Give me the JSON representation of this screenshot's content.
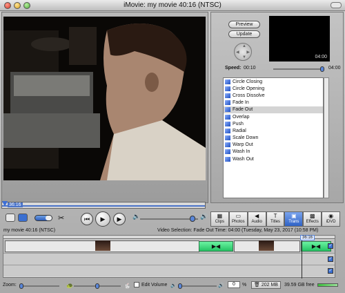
{
  "window": {
    "title": "iMovie: my movie  40:16 (NTSC)"
  },
  "monitor": {
    "scrub_timecode": "36:16"
  },
  "right_panel": {
    "preview_button": "Preview",
    "update_button": "Update",
    "preview_time": "04:00",
    "speed_label": "Speed:",
    "speed_min": "00:10",
    "speed_max": "04:00",
    "transitions": [
      "Circle Closing",
      "Circle Opening",
      "Cross Dissolve",
      "Fade In",
      "Fade Out",
      "Overlap",
      "Push",
      "Radial",
      "Scale Down",
      "Warp Out",
      "Wash In",
      "Wash Out"
    ],
    "selected_transition": "Fade Out"
  },
  "panes": [
    {
      "label": "Clips",
      "icon": "film-strip-icon"
    },
    {
      "label": "Photos",
      "icon": "camera-icon"
    },
    {
      "label": "Audio",
      "icon": "speaker-icon"
    },
    {
      "label": "Titles",
      "icon": "text-icon"
    },
    {
      "label": "Trans",
      "icon": "transition-icon",
      "active": true
    },
    {
      "label": "Effects",
      "icon": "effects-icon"
    },
    {
      "label": "iDVD",
      "icon": "dvd-icon"
    }
  ],
  "status": {
    "movie_info": "my movie  40:16 (NTSC)",
    "selection_info": "Video Selection: Fade Out Time: 04:00 (Tuesday, May 23, 2017 (10:58 PM)"
  },
  "timeline": {
    "playhead_time": "36:16"
  },
  "bottom": {
    "zoom_label": "Zoom:",
    "edit_volume_label": "Edit Volume",
    "volume_value": "0",
    "percent_sign": "%",
    "disk_usage": "202 MB",
    "free_space": "39.59 GB free"
  }
}
